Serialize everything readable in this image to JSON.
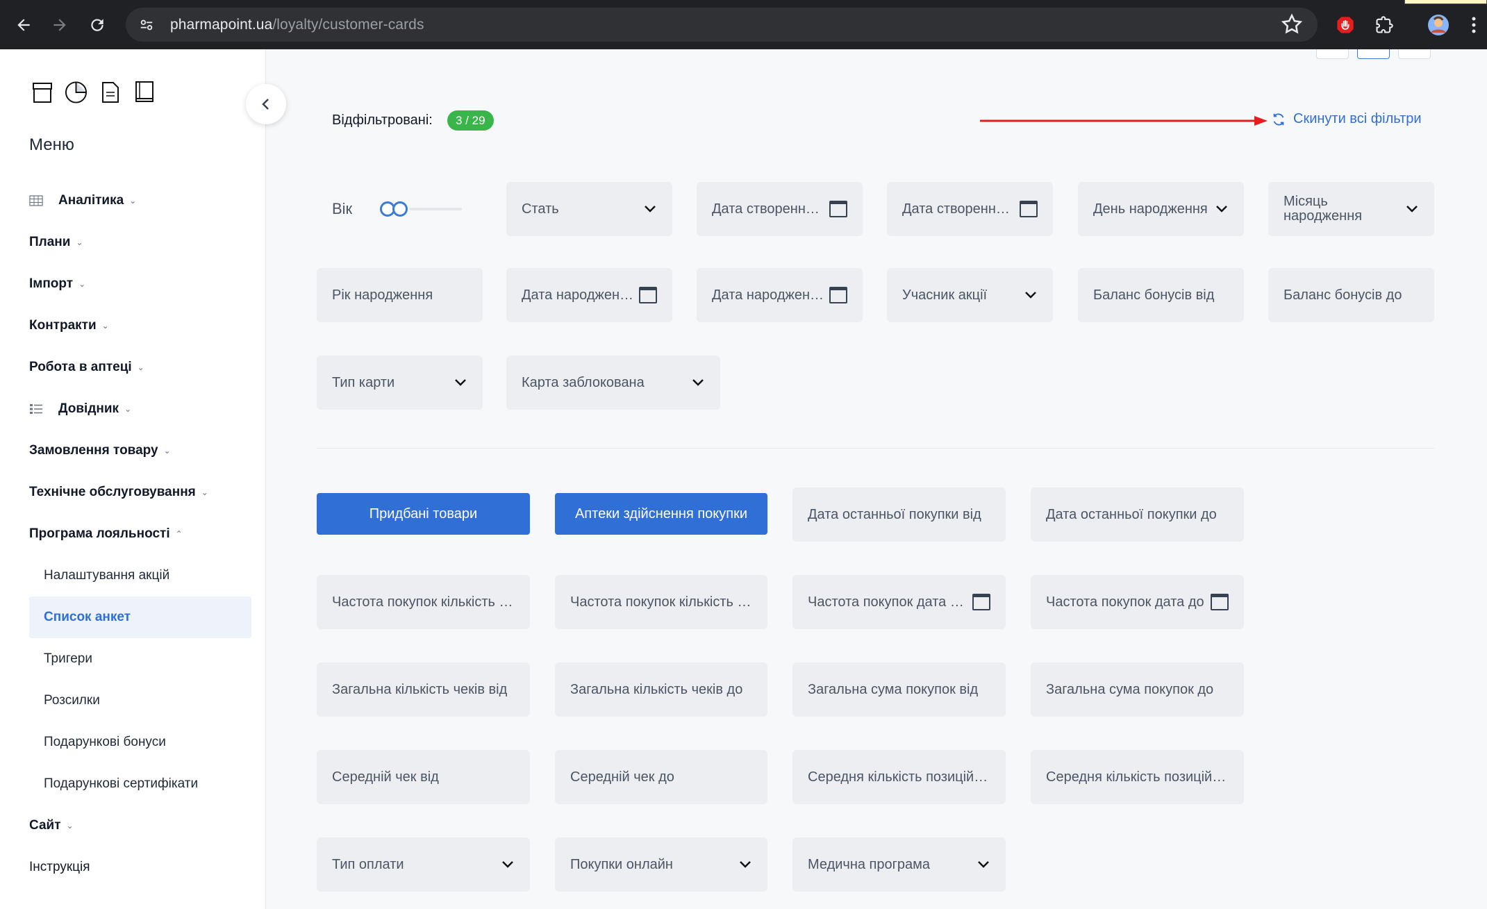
{
  "browser": {
    "url_domain": "pharmapoint.ua",
    "url_path": "/loyalty/customer-cards"
  },
  "sidebar": {
    "menu_title": "Меню",
    "items": [
      {
        "label": "Аналітика",
        "icon": "table-icon",
        "expandable": true
      },
      {
        "label": "Плани",
        "expandable": true
      },
      {
        "label": "Імпорт",
        "expandable": true
      },
      {
        "label": "Контракти",
        "expandable": true
      },
      {
        "label": "Робота в аптеці",
        "expandable": true
      },
      {
        "label": "Довідник",
        "icon": "list-icon",
        "expandable": true
      },
      {
        "label": "Замовлення товару",
        "expandable": true
      },
      {
        "label": "Технічне обслуговування",
        "expandable": true
      },
      {
        "label": "Програма лояльності",
        "expandable": true,
        "expanded": true
      }
    ],
    "sub_items": [
      {
        "label": "Налаштування акцій"
      },
      {
        "label": "Список анкет",
        "active": true
      },
      {
        "label": "Тригери"
      },
      {
        "label": "Розсилки"
      },
      {
        "label": "Подарункові бонуси"
      },
      {
        "label": "Подарункові сертифікати"
      }
    ],
    "after_items": [
      {
        "label": "Сайт",
        "expandable": true
      },
      {
        "label": "Інструкція",
        "expandable": false
      }
    ]
  },
  "filters_header": {
    "filtered_label": "Відфільтровані:",
    "filtered_count": "3 / 29",
    "reset_label": "Скинути всі фільтри"
  },
  "filters": {
    "age_label": "Вік",
    "gender": "Стать",
    "created_from": "Дата створення від",
    "created_to": "Дата створення до",
    "birth_day": "День народження",
    "birth_month": "Місяць народження",
    "birth_year": "Рік народження",
    "birth_date_from": "Дата народження від",
    "birth_date_to": "Дата народження до",
    "promo_participant": "Учасник акції",
    "bonus_from": "Баланс бонусів від",
    "bonus_to": "Баланс бонусів до",
    "card_type": "Тип карти",
    "card_blocked": "Карта заблокована"
  },
  "purchase_filters": {
    "bought_goods_btn": "Придбані товари",
    "pharmacies_btn": "Аптеки здійснення покупки",
    "last_purchase_from": "Дата останньої покупки від",
    "last_purchase_to": "Дата останньої покупки до",
    "freq_count_from": "Частота покупок кількість від",
    "freq_count_to": "Частота покупок кількість до",
    "freq_date_from": "Частота покупок дата від",
    "freq_date_to": "Частота покупок дата до",
    "checks_total_from": "Загальна кількість чеків від",
    "checks_total_to": "Загальна кількість чеків до",
    "sum_total_from": "Загальна сума покупок від",
    "sum_total_to": "Загальна сума покупок до",
    "avg_check_from": "Середній чек від",
    "avg_check_to": "Середній чек до",
    "avg_positions_from": "Середня кількість позицій від",
    "avg_positions_to": "Середня кількість позицій до",
    "payment_type": "Тип оплати",
    "online_purchases": "Покупки онлайн",
    "medical_program": "Медична програма"
  },
  "colors": {
    "accent": "#2f6fd6",
    "badge_green": "#39b54a",
    "arrow_red": "#e41e1e"
  }
}
